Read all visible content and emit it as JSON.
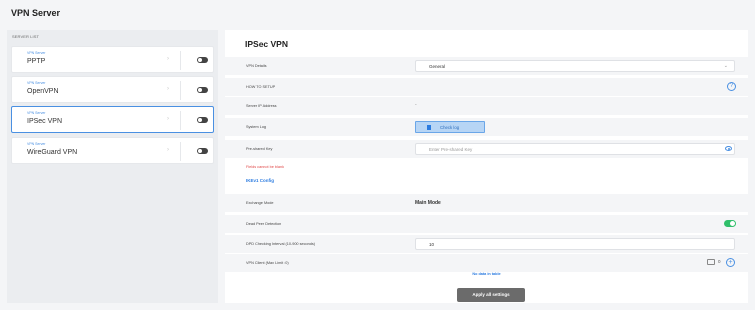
{
  "page": {
    "title": "VPN Server"
  },
  "server_list": {
    "label": "SERVER LIST",
    "items": [
      {
        "subtitle": "VPN Server",
        "name": "PPTP",
        "enabled": false,
        "selected": false
      },
      {
        "subtitle": "VPN Server",
        "name": "OpenVPN",
        "enabled": false,
        "selected": false
      },
      {
        "subtitle": "VPN Server",
        "name": "IPSec VPN",
        "enabled": false,
        "selected": true
      },
      {
        "subtitle": "VPN Server",
        "name": "WireGuard VPN",
        "enabled": false,
        "selected": false
      }
    ]
  },
  "detail": {
    "title": "IPSec VPN",
    "vpn_details": {
      "label": "VPN Details",
      "value": "General"
    },
    "how_to_setup": {
      "label": "HOW TO SETUP"
    },
    "server_ip": {
      "label": "Server IP Address",
      "value": "-"
    },
    "system_log": {
      "label": "System Log",
      "button": "Check log"
    },
    "preshared_key": {
      "label": "Pre-shared Key",
      "placeholder": "Enter Pre-shared Key"
    },
    "error": "Fields cannot be blank",
    "ikev1_link": "IKEv1 Config",
    "exchange_mode": {
      "label": "Exchange Mode",
      "value": "Main Mode"
    },
    "dead_peer": {
      "label": "Dead Peer Detection",
      "enabled": true
    },
    "dpd_interval": {
      "label": "DPD Checking Interval (10-900 seconds)",
      "value": "10"
    },
    "vpn_client": {
      "label": "VPN Client (Max Limit :0)",
      "count": "0"
    },
    "no_data": "No data in table",
    "apply_button": "Apply all settings"
  },
  "colors": {
    "accent": "#4a90e2",
    "toggle_on": "#2fbf6a",
    "error": "#e04848"
  },
  "icons": [
    "chevron-right-icon",
    "chevron-down-icon",
    "help-icon",
    "document-icon",
    "eye-icon",
    "device-icon",
    "add-icon"
  ]
}
